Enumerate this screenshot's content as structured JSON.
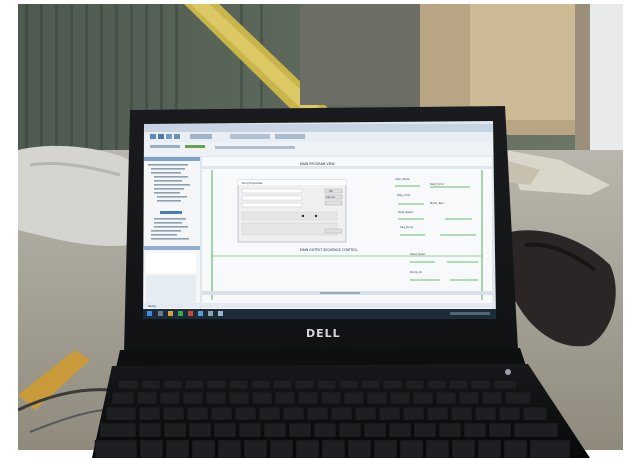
{
  "photo": {
    "laptop_brand": "DELL",
    "screen": {
      "canvas_title": "MAIN PROGRAM VIEW",
      "dialog_title": "Rung Properties",
      "dialog_ok": "OK",
      "dialog_cancel": "Cancel",
      "status_text": "Ready",
      "rung_comment": "MAIN OUTPUT SEQUENCE CONTROL",
      "ladder_labels": [
        "Auto_Mode",
        "Start_Cmd",
        "Stop_Cmd",
        "Motor_Run",
        "Fault_Reset",
        "Seq_Done",
        "Valve_Open",
        "Pump_On"
      ]
    },
    "accent_colors": {
      "screen_bg": "#dfe7ee",
      "rung_green": "#3aa845",
      "taskbar": "#1c2b3a"
    }
  }
}
